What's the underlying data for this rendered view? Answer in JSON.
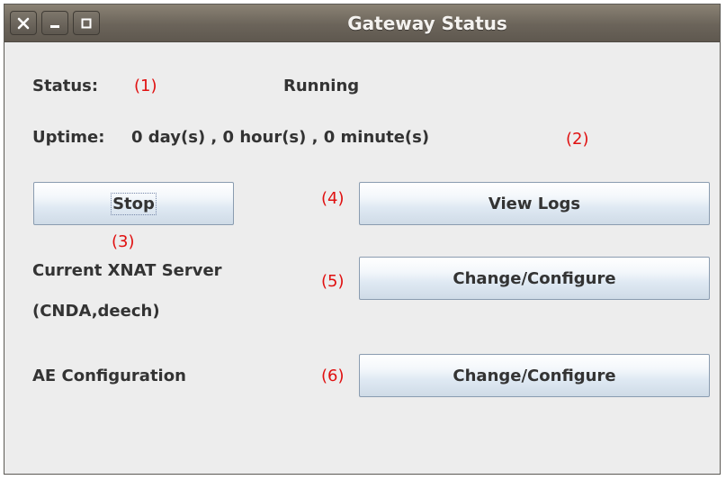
{
  "window": {
    "title": "Gateway Status",
    "controls": [
      {
        "name": "close-icon",
        "symbol": "close"
      },
      {
        "name": "minimize-icon",
        "symbol": "minimize"
      },
      {
        "name": "maximize-icon",
        "symbol": "maximize"
      }
    ]
  },
  "status": {
    "label": "Status:",
    "marker": "(1)",
    "value": "Running"
  },
  "uptime": {
    "label": "Uptime:",
    "value": "0 day(s) , 0 hour(s) , 0 minute(s)",
    "marker": "(2)"
  },
  "stop": {
    "label": "Stop",
    "marker": "(3)"
  },
  "view_logs": {
    "label": "View Logs",
    "marker": "(4)"
  },
  "xnat": {
    "label_line1": "Current XNAT Server",
    "label_line2": "(CNDA,deech)",
    "marker": "(5)",
    "button_label": "Change/Configure"
  },
  "ae": {
    "label": "AE Configuration",
    "marker": "(6)",
    "button_label": "Change/Configure"
  },
  "colors": {
    "annotation": "#e01010",
    "titlebar": "#6b645a",
    "window_bg": "#ededed"
  }
}
